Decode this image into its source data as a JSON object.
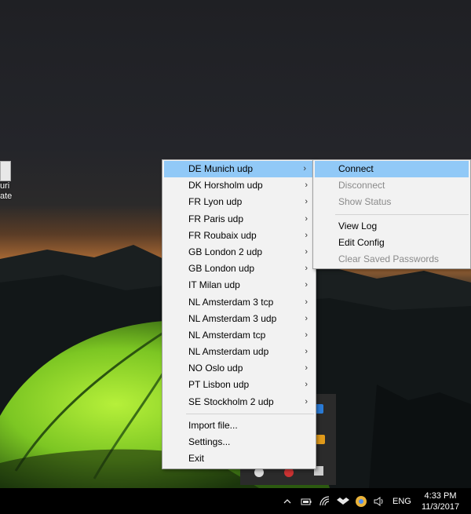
{
  "desktop_icon": {
    "label_line1": "uri",
    "label_line2": "ate"
  },
  "main_menu": {
    "servers": [
      {
        "label": "DE Munich udp",
        "highlighted": true
      },
      {
        "label": "DK Horsholm udp"
      },
      {
        "label": "FR Lyon udp"
      },
      {
        "label": "FR Paris udp"
      },
      {
        "label": "FR Roubaix udp"
      },
      {
        "label": "GB London 2 udp"
      },
      {
        "label": "GB London udp"
      },
      {
        "label": "IT Milan udp"
      },
      {
        "label": "NL Amsterdam 3 tcp"
      },
      {
        "label": "NL Amsterdam 3 udp"
      },
      {
        "label": "NL Amsterdam tcp"
      },
      {
        "label": "NL Amsterdam udp"
      },
      {
        "label": "NO Oslo udp"
      },
      {
        "label": "PT Lisbon udp"
      },
      {
        "label": "SE Stockholm 2 udp"
      }
    ],
    "import_label": "Import file...",
    "settings_label": "Settings...",
    "exit_label": "Exit",
    "submenu_arrow": "›"
  },
  "sub_menu": {
    "connect": "Connect",
    "disconnect": "Disconnect",
    "show_status": "Show Status",
    "view_log": "View Log",
    "edit_config": "Edit Config",
    "clear_passwords": "Clear Saved Passwords"
  },
  "taskbar": {
    "language": "ENG",
    "time": "4:33 PM",
    "date": "11/3/2017",
    "icons": [
      "chevron-up-icon",
      "battery-icon",
      "wifi-icon",
      "dropbox-icon",
      "chrome-icon",
      "volume-icon"
    ]
  },
  "colors": {
    "menu_bg": "#f2f2f2",
    "highlight": "#91c9f7",
    "disabled_text": "#8a8a8a",
    "taskbar": "#000000"
  }
}
